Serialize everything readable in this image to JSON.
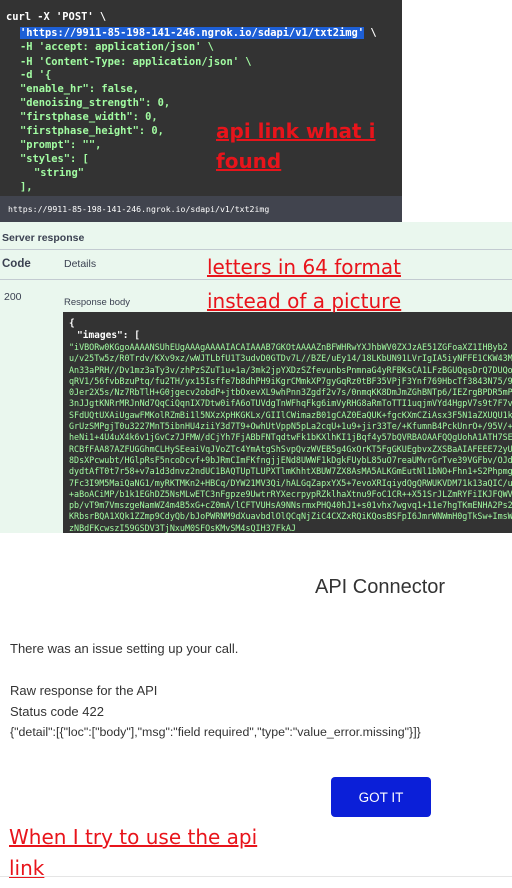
{
  "curl": {
    "lines": [
      "curl -X 'POST' \\",
      "'https://9911-85-198-141-246.ngrok.io/sdapi/v1/txt2img'",
      " \\",
      "-H 'accept: application/json' \\",
      "-H 'Content-Type: application/json' \\",
      "-d '{",
      "\"enable_hr\": false,",
      "\"denoising_strength\": 0,",
      "\"firstphase_width\": 0,",
      "\"firstphase_height\": 0,",
      "\"prompt\": \"\",",
      "\"styles\": [",
      "\"string\"",
      "],"
    ]
  },
  "request_url": "https://9911-85-198-141-246.ngrok.io/sdapi/v1/txt2img",
  "annotations": {
    "api_link_line1": "api link what i",
    "api_link_line2": "found",
    "letters_line1": "letters in 64 format",
    "letters_line2": "instead of a picture",
    "try_line1": "When I try to use the api",
    "try_line2": "link"
  },
  "server_response": {
    "label": "Server response",
    "col_code": "Code",
    "col_details": "Details",
    "row_code": "200",
    "body_label": "Response body",
    "open_brace": "{",
    "images_key": "\"images\": [",
    "base64": "\"iVBORw0KGgoAAAANSUhEUgAAAgAAAAIACAIAAAB7GKOtAAAAZnBFWHRwYXJhbWV0ZXJzAE51ZGFoaXZ1IHByb2u/v25Tw5z/R0Trdv/KXv9xz/wWJTLbfU1T3udvD0GTDv7L//BZE/uEy14/18LKbUN91LVrIgIA5iyNFFE1CKW43MAn33aPRH//Dv1mz3aTy3v/zhPzSZuT1u+1a/3mk2jpYXDzSZfevunbsPnmnaG4yRFBKsCA1LFzBGUQqsDrQ7DUQoqRV1/56fvbBzuPtq/fu2TH/yx15Isffe7b8dhPH9iKgrCMmkXP7gyGqRz0tBF35VPjF3Ynf769HbcTf3843N75/90Jer2X5s/Nz7RbTlH+G0jgecv2obdP+jtbOxevXL9whPnn3Zgdf2v7s/0nmqKK8DmJmZGhBNTp6/IEZrgBPDR5mP3nJJgtKNRrMRJnNd7QqCiQqnIX7Dtw0ifA6oTUVdgTnWFhqFkg6imVyRHG8aRmToTTI1uqjmVYd4HgpV7s9t7F7vSFdUQtUXAiUgawFMKolRZmBi1l5NXzXpHKGKLx/GIIlCWimazB01gCAZ0EaQUK+fgcKXmCZiAsx3F5N1aZXUQU1kGrUzSMPgjT0u3227MnT5ibnHU4ziiY3d7T9+OwhUtVppN5pLa2cqU+1u9+jir33Te/+KfumnB4PckUnrO+/95V/+heNi1+4U4uX4k6v1jGvCz7JFMW/dCjYh7FjABbFNTqdtwFk1bKXlhKI1jBqf4y57bQVRBAOAAFQQgUohA1ATH7SERCBfFAA87AZFUGGhmCLHySEeaiVqJVoZTc4YmAtgShSvpQvzWVEB5g4GxOrKT5FgGKUEgbvxZXSBaAIAFEEE72yU8DsXPcwubt/HGlpRsF5ncoDcvf+9bJRmCImFKfngjjENd8UWWF1kDgkFUybL85uO7reaUMvrGrTve39VGFbv/OJddydtAfT0t7r58+v7a1d3dnvz2ndUC1BAQTUpTLUPXTlmKhhtXBUW7ZX8AsMA5ALKGmEutNl1bNO+Fhn1+S2Phpmg7Fc3I9M5MaiQaNG1/myRKTMKn2+HBCq/DYW21MV3Qi/hALGqZapxYX5+7evoXRIqiydQgQRWUKVDM71k13aQIC/u+aBoACiMP/b1k1EGhDZ5NsMLwETC3nFgpze9UwtrRYXecrpypRZklhaXtnu9FoC1CR++X51SrJLZmRYFiIKJFQWVpb/vT9m7VmszgeNamWZ4m4B5xG+cZ0mA/lCFTVUHsA9NNsrmxPHQ40hJ1+s01vhx7wgvq1+11e7hgTKmENHA2Ps2KRbsrBQA1XQk1ZZmp9CdyQb/bJoPWRNM9dXuavbdlOlQCqNjZiC4CXZxRQiKQosBSFpI6JmrWNWmH0gTkSw+ImsWzNBdFKcwszI59GSDV3TjNxuM0SFOsKMvSM4sQIH37FkAJ"
  },
  "dialog": {
    "title": "API Connector",
    "message": "There was an issue setting up your call.",
    "raw_label": "Raw response for the API",
    "status": "Status code 422",
    "error_json": "{\"detail\":[{\"loc\":[\"body\"],\"msg\":\"field required\",\"type\":\"value_error.missing\"}]}",
    "button": "GOT IT"
  },
  "colors": {
    "code_bg": "#333333",
    "string_green": "#a2fca2",
    "url_highlight": "#1d5fd6",
    "annotation_red": "#e8141b",
    "response_bg": "#eaf7ee",
    "button_blue": "#0b1fd8"
  }
}
